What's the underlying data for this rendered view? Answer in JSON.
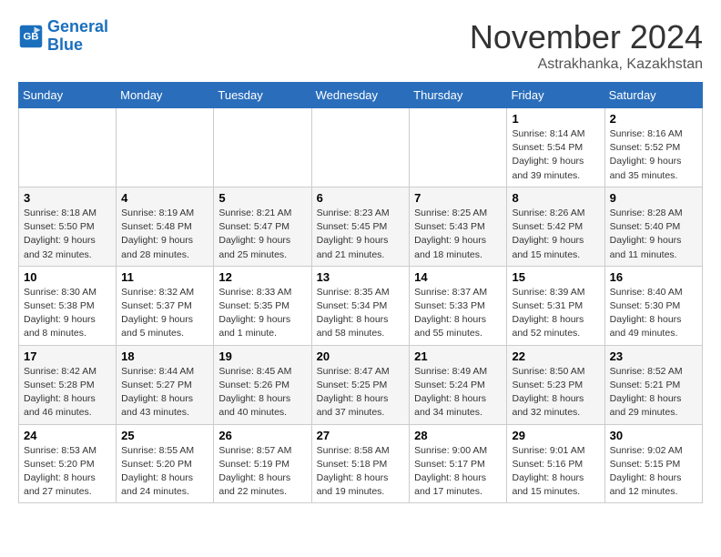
{
  "logo": {
    "line1": "General",
    "line2": "Blue"
  },
  "title": "November 2024",
  "subtitle": "Astrakhanka, Kazakhstan",
  "days_of_week": [
    "Sunday",
    "Monday",
    "Tuesday",
    "Wednesday",
    "Thursday",
    "Friday",
    "Saturday"
  ],
  "weeks": [
    [
      {
        "day": "",
        "info": ""
      },
      {
        "day": "",
        "info": ""
      },
      {
        "day": "",
        "info": ""
      },
      {
        "day": "",
        "info": ""
      },
      {
        "day": "",
        "info": ""
      },
      {
        "day": "1",
        "info": "Sunrise: 8:14 AM\nSunset: 5:54 PM\nDaylight: 9 hours and 39 minutes."
      },
      {
        "day": "2",
        "info": "Sunrise: 8:16 AM\nSunset: 5:52 PM\nDaylight: 9 hours and 35 minutes."
      }
    ],
    [
      {
        "day": "3",
        "info": "Sunrise: 8:18 AM\nSunset: 5:50 PM\nDaylight: 9 hours and 32 minutes."
      },
      {
        "day": "4",
        "info": "Sunrise: 8:19 AM\nSunset: 5:48 PM\nDaylight: 9 hours and 28 minutes."
      },
      {
        "day": "5",
        "info": "Sunrise: 8:21 AM\nSunset: 5:47 PM\nDaylight: 9 hours and 25 minutes."
      },
      {
        "day": "6",
        "info": "Sunrise: 8:23 AM\nSunset: 5:45 PM\nDaylight: 9 hours and 21 minutes."
      },
      {
        "day": "7",
        "info": "Sunrise: 8:25 AM\nSunset: 5:43 PM\nDaylight: 9 hours and 18 minutes."
      },
      {
        "day": "8",
        "info": "Sunrise: 8:26 AM\nSunset: 5:42 PM\nDaylight: 9 hours and 15 minutes."
      },
      {
        "day": "9",
        "info": "Sunrise: 8:28 AM\nSunset: 5:40 PM\nDaylight: 9 hours and 11 minutes."
      }
    ],
    [
      {
        "day": "10",
        "info": "Sunrise: 8:30 AM\nSunset: 5:38 PM\nDaylight: 9 hours and 8 minutes."
      },
      {
        "day": "11",
        "info": "Sunrise: 8:32 AM\nSunset: 5:37 PM\nDaylight: 9 hours and 5 minutes."
      },
      {
        "day": "12",
        "info": "Sunrise: 8:33 AM\nSunset: 5:35 PM\nDaylight: 9 hours and 1 minute."
      },
      {
        "day": "13",
        "info": "Sunrise: 8:35 AM\nSunset: 5:34 PM\nDaylight: 8 hours and 58 minutes."
      },
      {
        "day": "14",
        "info": "Sunrise: 8:37 AM\nSunset: 5:33 PM\nDaylight: 8 hours and 55 minutes."
      },
      {
        "day": "15",
        "info": "Sunrise: 8:39 AM\nSunset: 5:31 PM\nDaylight: 8 hours and 52 minutes."
      },
      {
        "day": "16",
        "info": "Sunrise: 8:40 AM\nSunset: 5:30 PM\nDaylight: 8 hours and 49 minutes."
      }
    ],
    [
      {
        "day": "17",
        "info": "Sunrise: 8:42 AM\nSunset: 5:28 PM\nDaylight: 8 hours and 46 minutes."
      },
      {
        "day": "18",
        "info": "Sunrise: 8:44 AM\nSunset: 5:27 PM\nDaylight: 8 hours and 43 minutes."
      },
      {
        "day": "19",
        "info": "Sunrise: 8:45 AM\nSunset: 5:26 PM\nDaylight: 8 hours and 40 minutes."
      },
      {
        "day": "20",
        "info": "Sunrise: 8:47 AM\nSunset: 5:25 PM\nDaylight: 8 hours and 37 minutes."
      },
      {
        "day": "21",
        "info": "Sunrise: 8:49 AM\nSunset: 5:24 PM\nDaylight: 8 hours and 34 minutes."
      },
      {
        "day": "22",
        "info": "Sunrise: 8:50 AM\nSunset: 5:23 PM\nDaylight: 8 hours and 32 minutes."
      },
      {
        "day": "23",
        "info": "Sunrise: 8:52 AM\nSunset: 5:21 PM\nDaylight: 8 hours and 29 minutes."
      }
    ],
    [
      {
        "day": "24",
        "info": "Sunrise: 8:53 AM\nSunset: 5:20 PM\nDaylight: 8 hours and 27 minutes."
      },
      {
        "day": "25",
        "info": "Sunrise: 8:55 AM\nSunset: 5:20 PM\nDaylight: 8 hours and 24 minutes."
      },
      {
        "day": "26",
        "info": "Sunrise: 8:57 AM\nSunset: 5:19 PM\nDaylight: 8 hours and 22 minutes."
      },
      {
        "day": "27",
        "info": "Sunrise: 8:58 AM\nSunset: 5:18 PM\nDaylight: 8 hours and 19 minutes."
      },
      {
        "day": "28",
        "info": "Sunrise: 9:00 AM\nSunset: 5:17 PM\nDaylight: 8 hours and 17 minutes."
      },
      {
        "day": "29",
        "info": "Sunrise: 9:01 AM\nSunset: 5:16 PM\nDaylight: 8 hours and 15 minutes."
      },
      {
        "day": "30",
        "info": "Sunrise: 9:02 AM\nSunset: 5:15 PM\nDaylight: 8 hours and 12 minutes."
      }
    ]
  ]
}
